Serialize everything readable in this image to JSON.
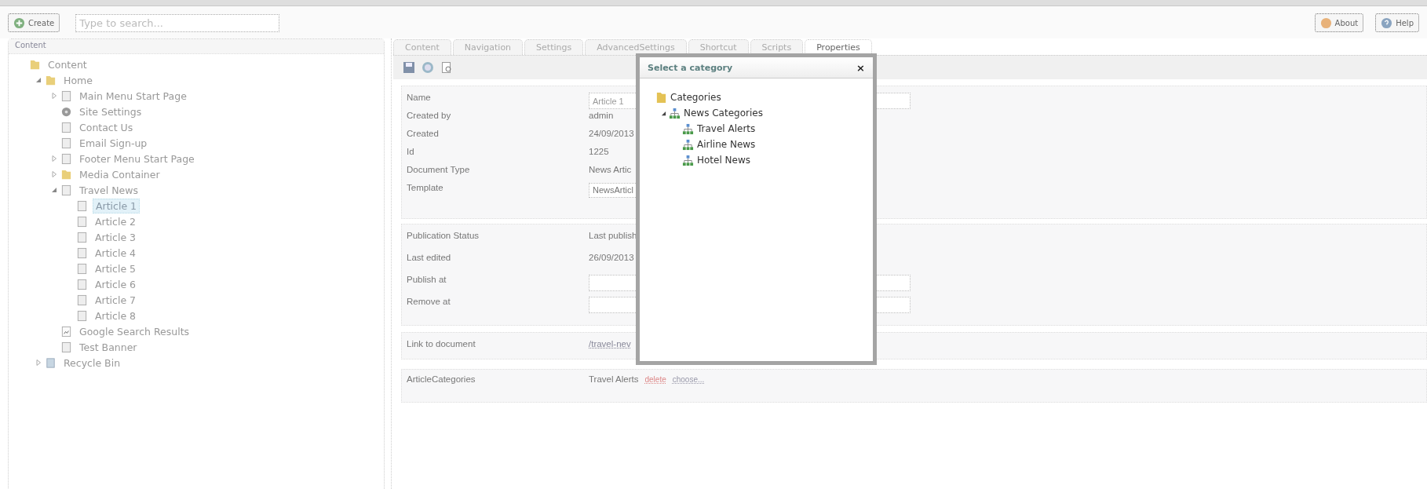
{
  "toolbar": {
    "create_label": "Create",
    "search": {
      "placeholder": "Type to search..."
    },
    "buttons": [
      {
        "kind": "about",
        "label": "About"
      },
      {
        "kind": "help",
        "label": "Help"
      }
    ]
  },
  "content_panel": {
    "title": "Content",
    "tree": [
      {
        "label": "Content",
        "kind": "folder",
        "selected": false,
        "children": [
          {
            "label": "Home",
            "kind": "folder",
            "expanded": true,
            "selected": false,
            "children": [
              {
                "label": "Main Menu Start Page",
                "kind": "page",
                "expanded": false,
                "selected": false
              },
              {
                "label": "Site Settings",
                "kind": "settings",
                "selected": false
              },
              {
                "label": "Contact Us",
                "kind": "page",
                "selected": false
              },
              {
                "label": "Email Sign-up",
                "kind": "page",
                "selected": false
              },
              {
                "label": "Footer Menu Start Page",
                "kind": "page",
                "expanded": false,
                "selected": false
              },
              {
                "label": "Media Container",
                "kind": "folder",
                "expanded": false,
                "selected": false
              },
              {
                "label": "Travel News",
                "kind": "page",
                "expanded": true,
                "selected": false,
                "children": [
                  {
                    "label": "Article 1",
                    "kind": "page",
                    "selected": true
                  },
                  {
                    "label": "Article 2",
                    "kind": "page",
                    "selected": false
                  },
                  {
                    "label": "Article 3",
                    "kind": "page",
                    "selected": false
                  },
                  {
                    "label": "Article 4",
                    "kind": "page",
                    "selected": false
                  },
                  {
                    "label": "Article 5",
                    "kind": "page",
                    "selected": false
                  },
                  {
                    "label": "Article 6",
                    "kind": "page",
                    "selected": false
                  },
                  {
                    "label": "Article 7",
                    "kind": "page",
                    "selected": false
                  },
                  {
                    "label": "Article 8",
                    "kind": "page",
                    "selected": false
                  }
                ]
              },
              {
                "label": "Google Search Results",
                "kind": "search",
                "selected": false
              },
              {
                "label": "Test Banner",
                "kind": "page",
                "selected": false
              }
            ]
          },
          {
            "label": "Recycle Bin",
            "kind": "recycle",
            "expanded": false,
            "selected": false
          }
        ]
      }
    ]
  },
  "tabs": [
    {
      "label": "Content",
      "selected": false
    },
    {
      "label": "Navigation",
      "selected": false
    },
    {
      "label": "Settings",
      "selected": false
    },
    {
      "label": "AdvancedSettings",
      "selected": false
    },
    {
      "label": "Shortcut",
      "selected": false
    },
    {
      "label": "Scripts",
      "selected": false
    },
    {
      "label": "Properties",
      "selected": true
    }
  ],
  "sections": [
    {
      "rows": [
        {
          "label": "Name",
          "kind": "input",
          "value": "Article 1"
        },
        {
          "label": "Created by",
          "kind": "text",
          "value": "admin"
        },
        {
          "label": "Created",
          "kind": "text",
          "value": "24/09/2013"
        },
        {
          "label": "Id",
          "kind": "text",
          "value": "1225"
        },
        {
          "label": "Document Type",
          "kind": "text",
          "value": "News Artic"
        },
        {
          "label": "Template",
          "kind": "select",
          "value": "NewsArticl"
        }
      ]
    },
    {
      "rows": [
        {
          "label": "Publication Status",
          "kind": "text",
          "value": "Last publish"
        },
        {
          "label": "Last edited",
          "kind": "text",
          "value": "26/09/2013"
        },
        {
          "label": "Publish at",
          "kind": "input",
          "value": ""
        },
        {
          "label": "Remove at",
          "kind": "input",
          "value": ""
        }
      ]
    },
    {
      "rows": [
        {
          "label": "Link to document",
          "kind": "link",
          "value": "/travel-nev"
        }
      ]
    },
    {
      "rows": [
        {
          "label": "ArticleCategories",
          "kind": "categories",
          "value": "Travel Alerts",
          "links": [
            {
              "label": "delete",
              "kind": "danger"
            },
            {
              "label": "choose...",
              "kind": "normal"
            }
          ]
        }
      ]
    }
  ],
  "dialog": {
    "title": "Select a category",
    "close": "×",
    "tree": [
      {
        "label": "Categories",
        "kind": "folder",
        "children": [
          {
            "label": "News Categories",
            "kind": "hierarchy",
            "expanded": true,
            "children": [
              {
                "label": "Travel Alerts",
                "kind": "hierarchy"
              },
              {
                "label": "Airline News",
                "kind": "hierarchy"
              },
              {
                "label": "Hotel News",
                "kind": "hierarchy"
              }
            ]
          }
        ]
      }
    ]
  }
}
